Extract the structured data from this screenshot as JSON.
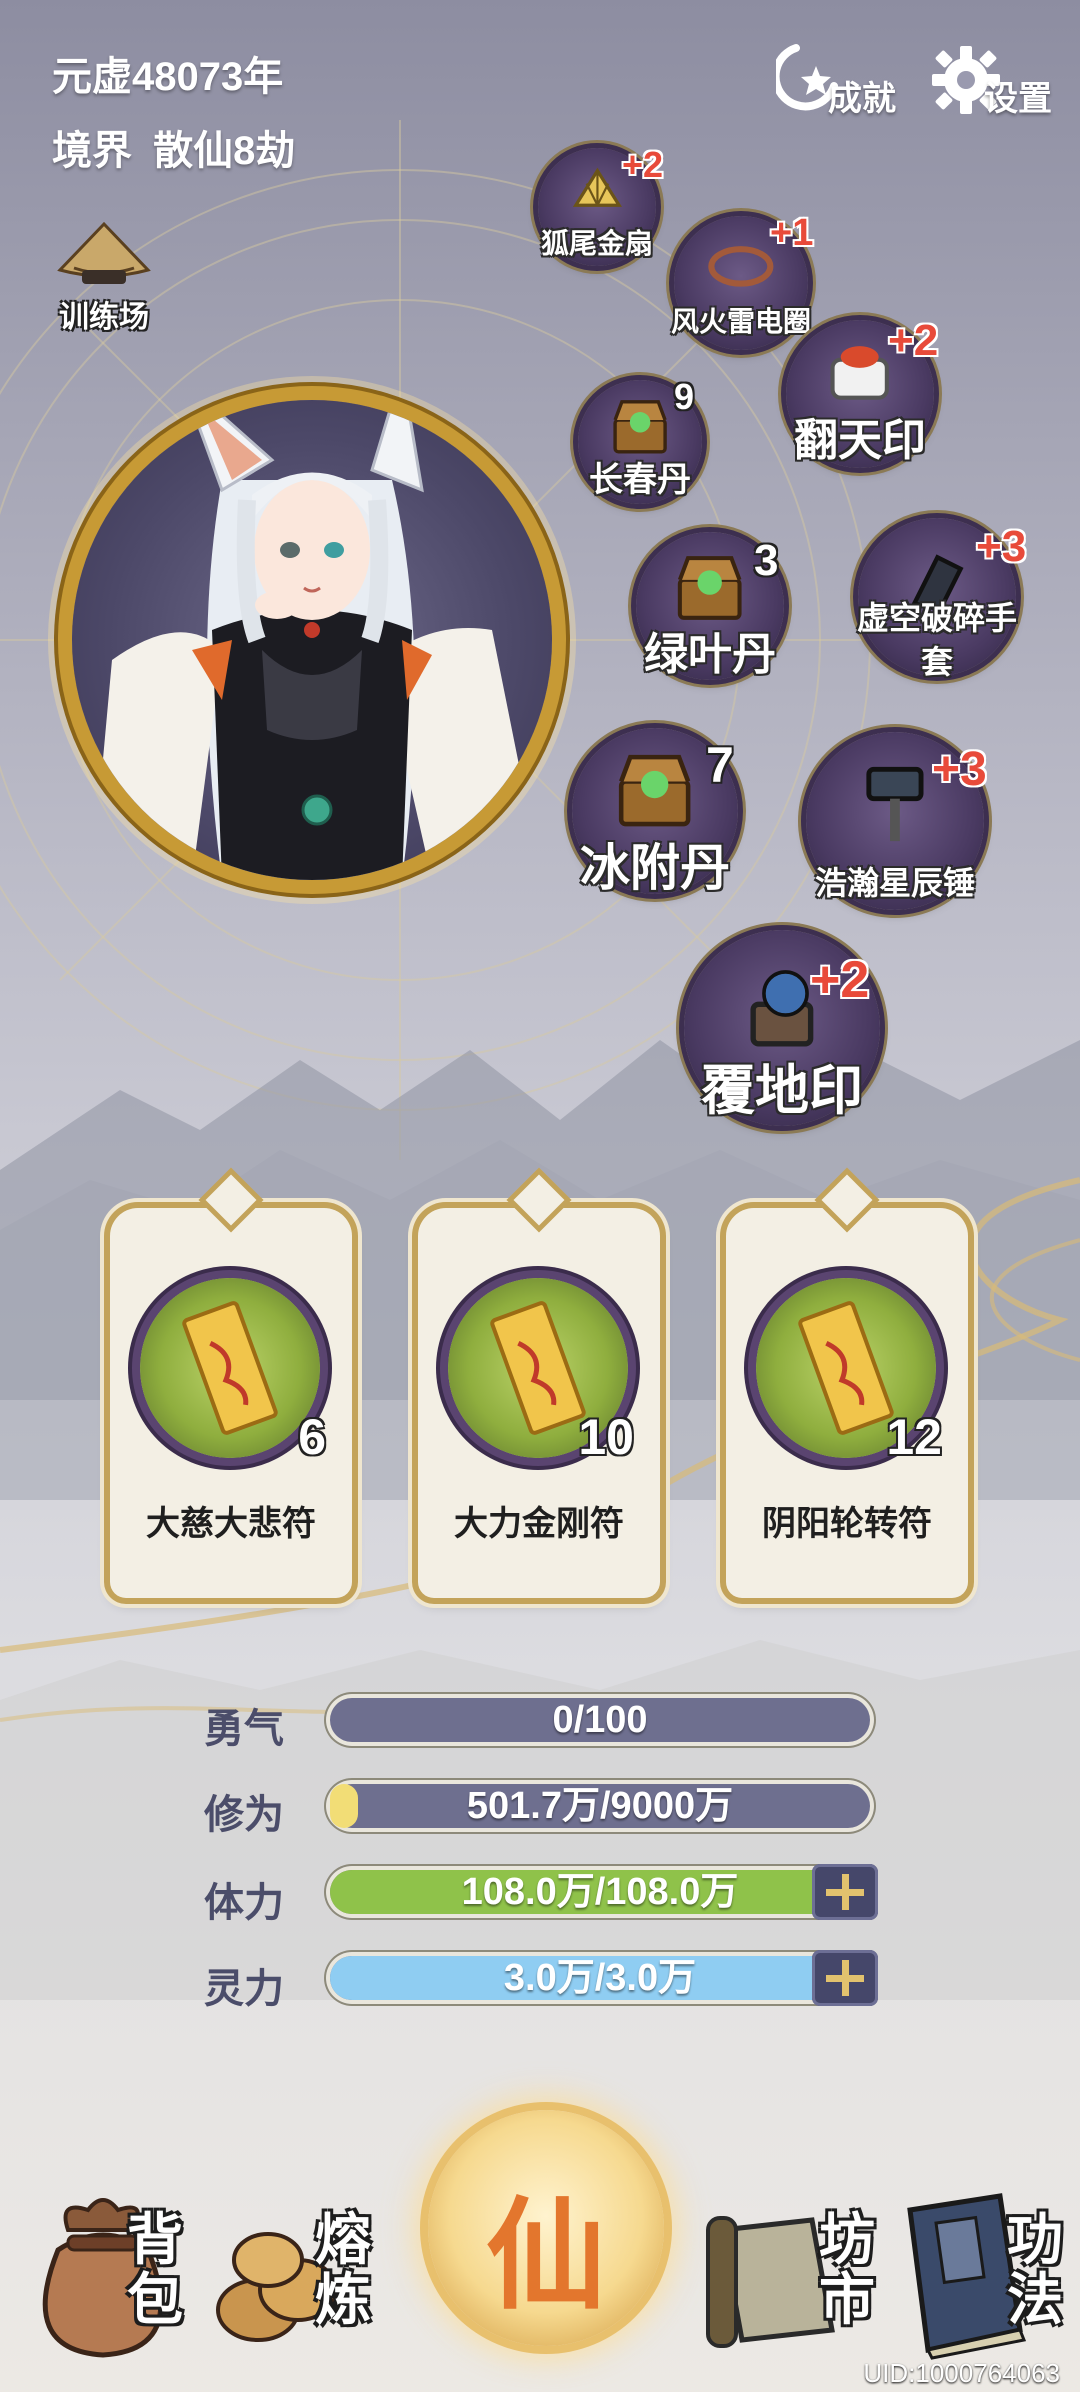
{
  "header": {
    "year_text": "元虚48073年",
    "realm_label": "境界",
    "realm_value": "散仙8劫",
    "achievement_label": "成就",
    "settings_label": "设置",
    "training_label": "训练场"
  },
  "items": [
    {
      "name": "狐尾金扇",
      "bonus": "+2",
      "icon": "fan-icon"
    },
    {
      "name": "风火雷电圈",
      "bonus": "+1",
      "icon": "ring-icon"
    },
    {
      "name": "翻天印",
      "bonus": "+2",
      "icon": "seal-icon"
    },
    {
      "name": "长春丹",
      "count": "9",
      "icon": "chest-pill-icon"
    },
    {
      "name": "绿叶丹",
      "count": "3",
      "icon": "chest-pill-icon"
    },
    {
      "name": "虚空破碎手套",
      "bonus": "+3",
      "icon": "glove-icon"
    },
    {
      "name": "冰附丹",
      "count": "7",
      "icon": "chest-pill-icon"
    },
    {
      "name": "浩瀚星辰锤",
      "bonus": "+3",
      "icon": "hammer-icon"
    },
    {
      "name": "覆地印",
      "bonus": "+2",
      "icon": "orb-seal-icon"
    }
  ],
  "talismans": [
    {
      "name": "大慈大悲符",
      "count": "6"
    },
    {
      "name": "大力金刚符",
      "count": "10"
    },
    {
      "name": "阴阳轮转符",
      "count": "12"
    }
  ],
  "stats": [
    {
      "label": "勇气",
      "value": "0/100",
      "fill": 0.0,
      "color": "#6e6f8f"
    },
    {
      "label": "修为",
      "value": "501.7万/9000万",
      "fill": 0.056,
      "color": "#f2dd76"
    },
    {
      "label": "体力",
      "value": "108.0万/108.0万",
      "fill": 1.0,
      "color": "#8fc24a"
    },
    {
      "label": "灵力",
      "value": "3.0万/3.0万",
      "fill": 1.0,
      "color": "#8fcdf2"
    }
  ],
  "nav": {
    "bag": "背包",
    "smelt": "熔炼",
    "center": "仙",
    "market": "坊市",
    "skills": "功法"
  },
  "uid": "UID:1000764063"
}
